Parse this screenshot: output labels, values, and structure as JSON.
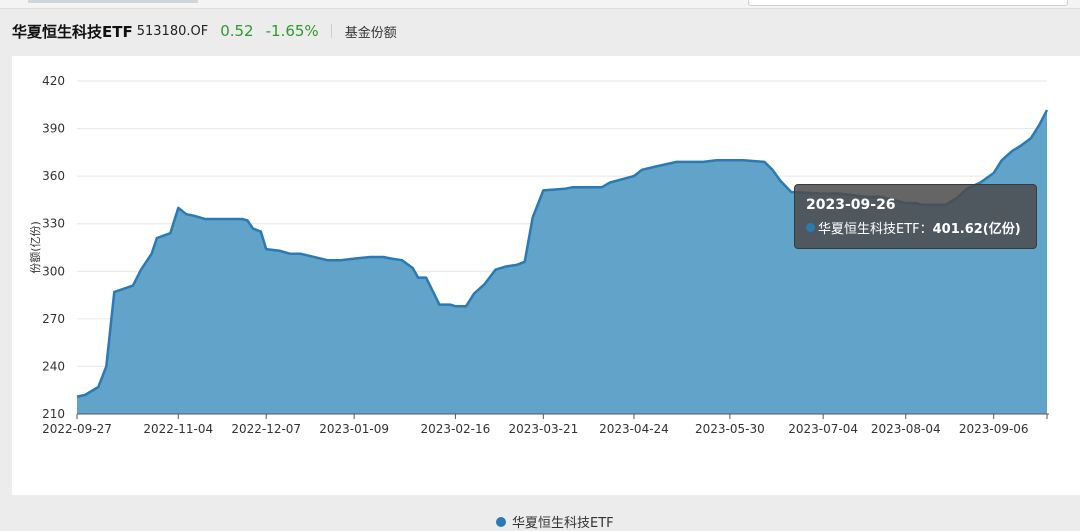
{
  "header": {
    "fund_name": "华夏恒生科技ETF",
    "fund_code": "513180.OF",
    "price": "0.52",
    "change": "-1.65%",
    "metric": "基金份额"
  },
  "colors": {
    "area": "#62a3c9",
    "line": "#2a7ab5",
    "positive": "#2d9a2d"
  },
  "chart_data": {
    "type": "area",
    "title": "",
    "ylabel": "份额(亿份)",
    "ylim": [
      210,
      420
    ],
    "yticks": [
      210,
      240,
      270,
      300,
      330,
      360,
      390,
      420
    ],
    "xticks": [
      "2022-09-27",
      "2022-11-04",
      "2022-12-07",
      "2023-01-09",
      "2023-02-16",
      "2023-03-21",
      "2023-04-24",
      "2023-05-30",
      "2023-07-04",
      "2023-08-04",
      "2023-09-06"
    ],
    "grid": true,
    "legend_position": "bottom",
    "series": [
      {
        "name": "华夏恒生科技ETF",
        "x": [
          "2022-09-27",
          "2022-09-30",
          "2022-10-05",
          "2022-10-08",
          "2022-10-11",
          "2022-10-18",
          "2022-10-21",
          "2022-10-25",
          "2022-10-27",
          "2022-11-01",
          "2022-11-04",
          "2022-11-07",
          "2022-11-10",
          "2022-11-14",
          "2022-11-22",
          "2022-11-28",
          "2022-11-30",
          "2022-12-02",
          "2022-12-05",
          "2022-12-07",
          "2022-12-12",
          "2022-12-16",
          "2022-12-20",
          "2022-12-30",
          "2023-01-04",
          "2023-01-09",
          "2023-01-15",
          "2023-01-20",
          "2023-01-23",
          "2023-01-27",
          "2023-01-31",
          "2023-02-02",
          "2023-02-05",
          "2023-02-10",
          "2023-02-14",
          "2023-02-16",
          "2023-02-20",
          "2023-02-23",
          "2023-02-27",
          "2023-03-03",
          "2023-03-07",
          "2023-03-11",
          "2023-03-14",
          "2023-03-17",
          "2023-03-21",
          "2023-03-29",
          "2023-04-01",
          "2023-04-08",
          "2023-04-12",
          "2023-04-15",
          "2023-04-24",
          "2023-04-27",
          "2023-05-02",
          "2023-05-10",
          "2023-05-20",
          "2023-05-25",
          "2023-05-30",
          "2023-06-04",
          "2023-06-12",
          "2023-06-15",
          "2023-06-18",
          "2023-06-22",
          "2023-07-04",
          "2023-07-10",
          "2023-07-15",
          "2023-07-20",
          "2023-07-25",
          "2023-07-28",
          "2023-08-04",
          "2023-08-08",
          "2023-08-10",
          "2023-08-12",
          "2023-08-16",
          "2023-08-19",
          "2023-08-23",
          "2023-08-27",
          "2023-09-01",
          "2023-09-06",
          "2023-09-09",
          "2023-09-13",
          "2023-09-16",
          "2023-09-20",
          "2023-09-23",
          "2023-09-26"
        ],
        "values": [
          221,
          222,
          227,
          240,
          287,
          291,
          301,
          311,
          321,
          324,
          340,
          336,
          335,
          333,
          333,
          333,
          332,
          327,
          325,
          314,
          313,
          311,
          311,
          307,
          307,
          308,
          309,
          309,
          308,
          307,
          302,
          296,
          296,
          279,
          279,
          278,
          278,
          286,
          292,
          301,
          303,
          304,
          306,
          334,
          351,
          352,
          353,
          353,
          353,
          356,
          360,
          364,
          366,
          369,
          369,
          370,
          370,
          370,
          369,
          364,
          357,
          350,
          349,
          349,
          348,
          347,
          347,
          346,
          343,
          343,
          342,
          342,
          342,
          342,
          346,
          352,
          356,
          362,
          370,
          376,
          379,
          384,
          392,
          401.62
        ]
      }
    ],
    "tooltip": {
      "date": "2023-09-26",
      "label": "华夏恒生科技ETF：",
      "value": "401.62(亿份)"
    }
  }
}
